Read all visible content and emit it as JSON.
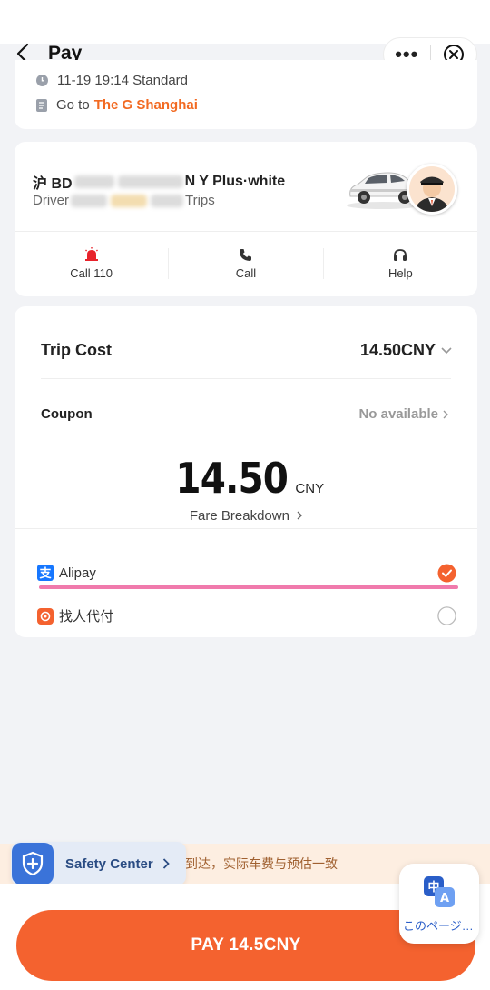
{
  "header": {
    "title": "Pay"
  },
  "trip": {
    "time_text": "11-19 19:14 Standard",
    "dest_prefix": "Go to",
    "dest_name": "The G Shanghai"
  },
  "driver_card": {
    "plate_prefix": "沪 BD",
    "car_model": "N Y Plus·white",
    "driver_prefix": "Driver",
    "trips_suffix": "Trips",
    "actions": [
      {
        "label": "Call 110"
      },
      {
        "label": "Call"
      },
      {
        "label": "Help"
      }
    ]
  },
  "payment": {
    "trip_cost_label": "Trip Cost",
    "trip_cost_value": "14.50CNY",
    "coupon_label": "Coupon",
    "coupon_value": "No available",
    "amount": "14.50",
    "currency": "CNY",
    "fare_breakdown": "Fare Breakdown",
    "methods": [
      {
        "label": "Alipay",
        "selected": true
      },
      {
        "label": "找人代付",
        "selected": false
      }
    ]
  },
  "notice": {
    "text": "到达，实际车费与预估一致"
  },
  "safety": {
    "label": "Safety Center"
  },
  "pay_button": {
    "label": "PAY 14.5CNY"
  },
  "translate": {
    "label": "このページ…"
  },
  "colors": {
    "accent": "#f4622f",
    "destination": "#f26a22",
    "alipay": "#1677ff",
    "safety_blue": "#3a73d9",
    "highlight_pink": "#f07aac"
  }
}
